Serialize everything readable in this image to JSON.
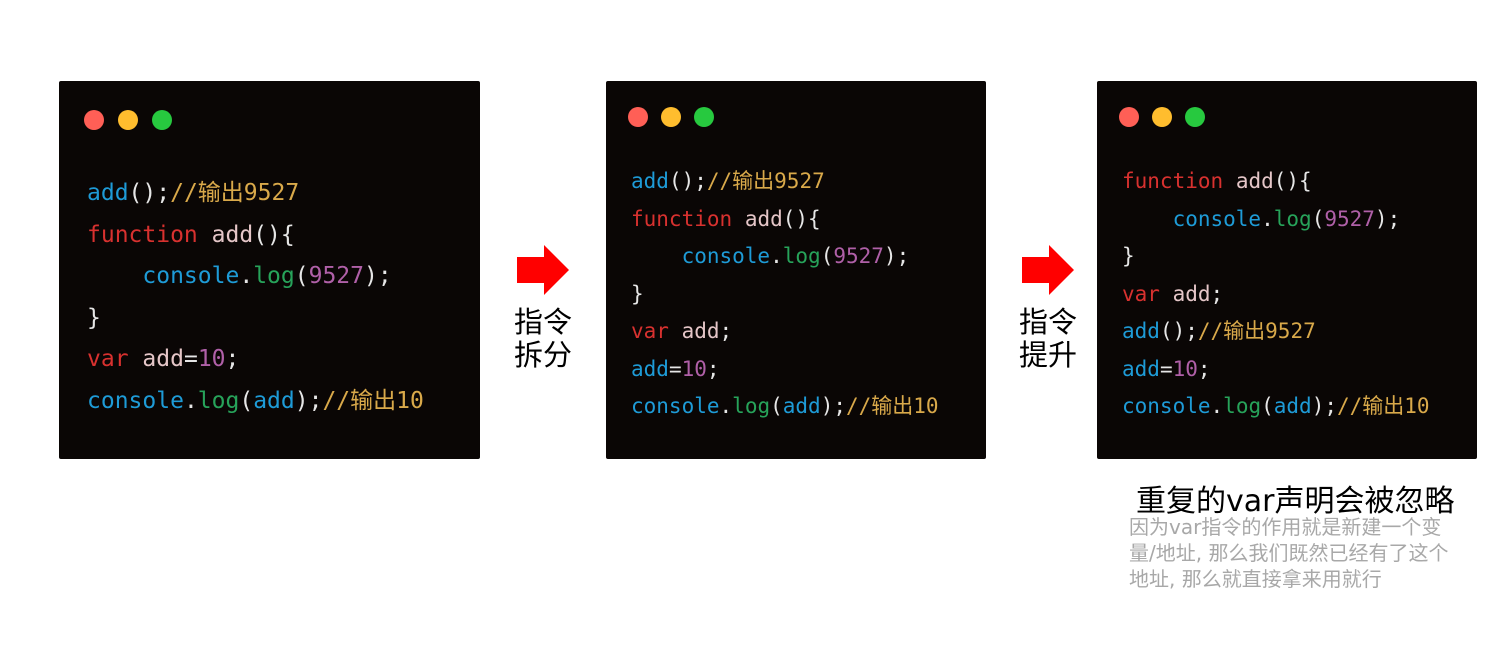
{
  "panels": [
    {
      "lines": [
        [
          {
            "t": "add",
            "c": "ident"
          },
          {
            "t": "();",
            "c": "punct"
          },
          {
            "t": "//输出9527",
            "c": "comment"
          }
        ],
        [
          {
            "t": "function",
            "c": "keyword"
          },
          {
            "t": " ",
            "c": "punct"
          },
          {
            "t": "add",
            "c": "fname"
          },
          {
            "t": "(){",
            "c": "punct"
          }
        ],
        [
          {
            "t": "    ",
            "c": "punct"
          },
          {
            "t": "console",
            "c": "ident"
          },
          {
            "t": ".",
            "c": "punct"
          },
          {
            "t": "log",
            "c": "method"
          },
          {
            "t": "(",
            "c": "punct"
          },
          {
            "t": "9527",
            "c": "number"
          },
          {
            "t": ");",
            "c": "punct"
          }
        ],
        [
          {
            "t": "}",
            "c": "punct"
          }
        ],
        [
          {
            "t": "var",
            "c": "keyword"
          },
          {
            "t": " ",
            "c": "punct"
          },
          {
            "t": "add",
            "c": "var"
          },
          {
            "t": "=",
            "c": "punct"
          },
          {
            "t": "10",
            "c": "number"
          },
          {
            "t": ";",
            "c": "punct"
          }
        ],
        [
          {
            "t": "console",
            "c": "ident"
          },
          {
            "t": ".",
            "c": "punct"
          },
          {
            "t": "log",
            "c": "method"
          },
          {
            "t": "(",
            "c": "punct"
          },
          {
            "t": "add",
            "c": "ident"
          },
          {
            "t": ");",
            "c": "punct"
          },
          {
            "t": "//输出10",
            "c": "comment"
          }
        ]
      ]
    },
    {
      "lines": [
        [
          {
            "t": "add",
            "c": "ident"
          },
          {
            "t": "();",
            "c": "punct"
          },
          {
            "t": "//输出9527",
            "c": "comment"
          }
        ],
        [
          {
            "t": "function",
            "c": "keyword"
          },
          {
            "t": " ",
            "c": "punct"
          },
          {
            "t": "add",
            "c": "fname"
          },
          {
            "t": "(){",
            "c": "punct"
          }
        ],
        [
          {
            "t": "    ",
            "c": "punct"
          },
          {
            "t": "console",
            "c": "ident"
          },
          {
            "t": ".",
            "c": "punct"
          },
          {
            "t": "log",
            "c": "method"
          },
          {
            "t": "(",
            "c": "punct"
          },
          {
            "t": "9527",
            "c": "number"
          },
          {
            "t": ");",
            "c": "punct"
          }
        ],
        [
          {
            "t": "}",
            "c": "punct"
          }
        ],
        [
          {
            "t": "var",
            "c": "keyword"
          },
          {
            "t": " ",
            "c": "punct"
          },
          {
            "t": "add",
            "c": "var"
          },
          {
            "t": ";",
            "c": "punct"
          }
        ],
        [
          {
            "t": "add",
            "c": "ident"
          },
          {
            "t": "=",
            "c": "punct"
          },
          {
            "t": "10",
            "c": "number"
          },
          {
            "t": ";",
            "c": "punct"
          }
        ],
        [
          {
            "t": "console",
            "c": "ident"
          },
          {
            "t": ".",
            "c": "punct"
          },
          {
            "t": "log",
            "c": "method"
          },
          {
            "t": "(",
            "c": "punct"
          },
          {
            "t": "add",
            "c": "ident"
          },
          {
            "t": ");",
            "c": "punct"
          },
          {
            "t": "//输出10",
            "c": "comment"
          }
        ]
      ]
    },
    {
      "lines": [
        [
          {
            "t": "function",
            "c": "keyword"
          },
          {
            "t": " ",
            "c": "punct"
          },
          {
            "t": "add",
            "c": "fname"
          },
          {
            "t": "(){",
            "c": "punct"
          }
        ],
        [
          {
            "t": "    ",
            "c": "punct"
          },
          {
            "t": "console",
            "c": "ident"
          },
          {
            "t": ".",
            "c": "punct"
          },
          {
            "t": "log",
            "c": "method"
          },
          {
            "t": "(",
            "c": "punct"
          },
          {
            "t": "9527",
            "c": "number"
          },
          {
            "t": ");",
            "c": "punct"
          }
        ],
        [
          {
            "t": "}",
            "c": "punct"
          }
        ],
        [
          {
            "t": "var",
            "c": "keyword"
          },
          {
            "t": " ",
            "c": "punct"
          },
          {
            "t": "add",
            "c": "var"
          },
          {
            "t": ";",
            "c": "punct"
          }
        ],
        [
          {
            "t": "add",
            "c": "ident"
          },
          {
            "t": "();",
            "c": "punct"
          },
          {
            "t": "//输出9527",
            "c": "comment"
          }
        ],
        [
          {
            "t": "add",
            "c": "ident"
          },
          {
            "t": "=",
            "c": "punct"
          },
          {
            "t": "10",
            "c": "number"
          },
          {
            "t": ";",
            "c": "punct"
          }
        ],
        [
          {
            "t": "console",
            "c": "ident"
          },
          {
            "t": ".",
            "c": "punct"
          },
          {
            "t": "log",
            "c": "method"
          },
          {
            "t": "(",
            "c": "punct"
          },
          {
            "t": "add",
            "c": "ident"
          },
          {
            "t": ");",
            "c": "punct"
          },
          {
            "t": "//输出10",
            "c": "comment"
          }
        ]
      ]
    }
  ],
  "arrows": [
    {
      "label_line1": "指令",
      "label_line2": "拆分"
    },
    {
      "label_line1": "指令",
      "label_line2": "提升"
    }
  ],
  "caption": {
    "title": "重复的var声明会被忽略",
    "body": "因为var指令的作用就是新建一个变量/地址, 那么我们既然已经有了这个地址, 那么就直接拿来用就行"
  },
  "colors": {
    "panel_bg": "#0a0605",
    "arrow": "#ff0000",
    "dot_red": "#ff5f56",
    "dot_yellow": "#ffbd2e",
    "dot_green": "#27c93f",
    "ident": "#1e9bd7",
    "keyword": "#d8312f",
    "method": "#27a35a",
    "number": "#b060a8",
    "comment": "#d9a94a"
  }
}
